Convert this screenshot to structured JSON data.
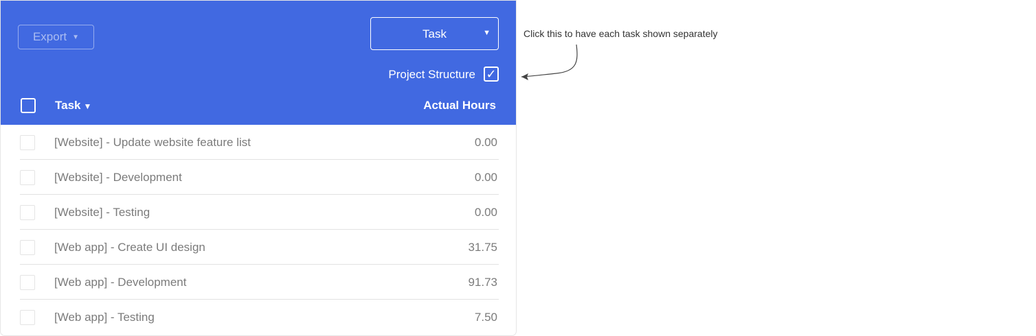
{
  "toolbar": {
    "export_label": "Export",
    "group_by_value": "Task",
    "project_structure_label": "Project Structure",
    "project_structure_checked": true
  },
  "table": {
    "columns": {
      "task": "Task",
      "hours": "Actual Hours"
    },
    "rows": [
      {
        "task": "[Website] - Update website feature list",
        "hours": "0.00"
      },
      {
        "task": "[Website] - Development",
        "hours": "0.00"
      },
      {
        "task": "[Website] - Testing",
        "hours": "0.00"
      },
      {
        "task": "[Web app] - Create UI design",
        "hours": "31.75"
      },
      {
        "task": "[Web app] - Development",
        "hours": "91.73"
      },
      {
        "task": "[Web app] - Testing",
        "hours": "7.50"
      }
    ]
  },
  "annotation": {
    "text": "Click this to have each task shown separately"
  },
  "colors": {
    "header_bg": "#4169e1",
    "row_text": "#7b7b7b",
    "annotation_text": "#333333"
  },
  "icons": {
    "dropdown": "caret-down-icon",
    "check": "checkmark-icon",
    "arrow": "curved-arrow-icon"
  }
}
